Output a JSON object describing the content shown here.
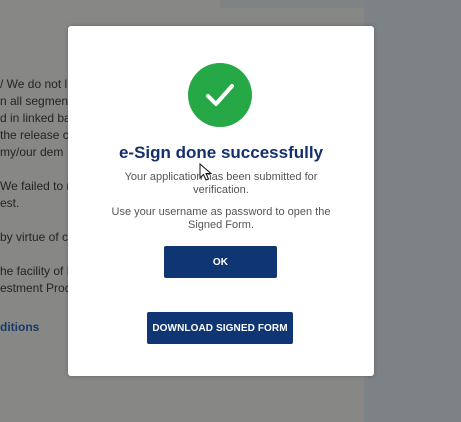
{
  "background": {
    "lines": [
      "/ We do not l",
      "n all segmen",
      "d in linked ba",
      "the release c",
      " my/our dem",
      "We failed to r",
      "est.",
      "by virtue of c",
      "he facility of D",
      "estment Prod"
    ],
    "link_text": "ditions"
  },
  "modal": {
    "title": "e-Sign done successfully",
    "message_1": "Your application has been submitted for verification.",
    "message_2": "Use your username as password to open the Signed Form.",
    "ok_label": "OK",
    "download_label": "DOWNLOAD SIGNED FORM",
    "icon": "check-circle-icon"
  },
  "colors": {
    "success": "#27a846",
    "primary": "#0f3573",
    "title": "#14306d",
    "overlay": "#878886"
  }
}
